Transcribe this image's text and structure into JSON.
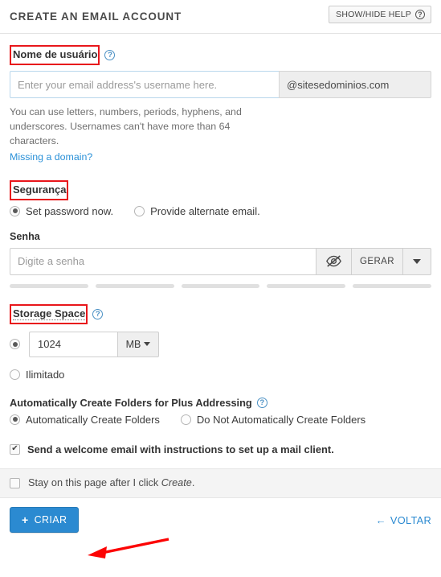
{
  "header": {
    "title": "CREATE AN EMAIL ACCOUNT",
    "help_toggle_label": "SHOW/HIDE HELP",
    "help_icon": "question-circle-icon"
  },
  "username": {
    "label": "Nome de usuário",
    "help_icon": "question-circle-icon",
    "input_placeholder": "Enter your email address's username here.",
    "input_value": "",
    "domain": "@sitesedominios.com",
    "help_text": "You can use letters, numbers, periods, hyphens, and underscores. Usernames can't have more than 64 characters.",
    "missing_domain_link": "Missing a domain?"
  },
  "security": {
    "label": "Segurança",
    "options": [
      {
        "label": "Set password now.",
        "checked": true
      },
      {
        "label": "Provide alternate email.",
        "checked": false
      }
    ],
    "password_label": "Senha",
    "password_placeholder": "Digite a senha",
    "password_value": "",
    "toggle_visibility_icon": "eye-slash-icon",
    "generate_label": "GERAR",
    "dropdown_icon": "caret-down-icon",
    "strength_segments": 5,
    "strength_filled": 0
  },
  "storage": {
    "label": "Storage Space",
    "help_icon": "question-circle-icon",
    "quota_value": "1024",
    "unit": "MB",
    "unit_caret_icon": "caret-down-icon",
    "unlimited_label": "Ilimitado",
    "quota_selected": true,
    "unlimited_selected": false
  },
  "plus_addressing": {
    "title": "Automatically Create Folders for Plus Addressing",
    "help_icon": "question-circle-icon",
    "options": [
      {
        "label": "Automatically Create Folders",
        "checked": true
      },
      {
        "label": "Do Not Automatically Create Folders",
        "checked": false
      }
    ]
  },
  "welcome": {
    "label": "Send a welcome email with instructions to set up a mail client.",
    "checked": true
  },
  "stay_on_page": {
    "prefix": "Stay on this page after I click ",
    "emphasis": "Create",
    "suffix": ".",
    "checked": false
  },
  "footer": {
    "create_label": "CRIAR",
    "create_icon": "plus-icon",
    "back_label": "VOLTAR",
    "back_icon": "arrow-left-icon"
  },
  "annotations": {
    "highlight_color": "#e8161b",
    "arrow_color": "#fc0404",
    "accent_color": "#2b8ad1",
    "highlighted_labels": [
      "Nome de usuário",
      "Segurança",
      "Storage Space"
    ]
  }
}
